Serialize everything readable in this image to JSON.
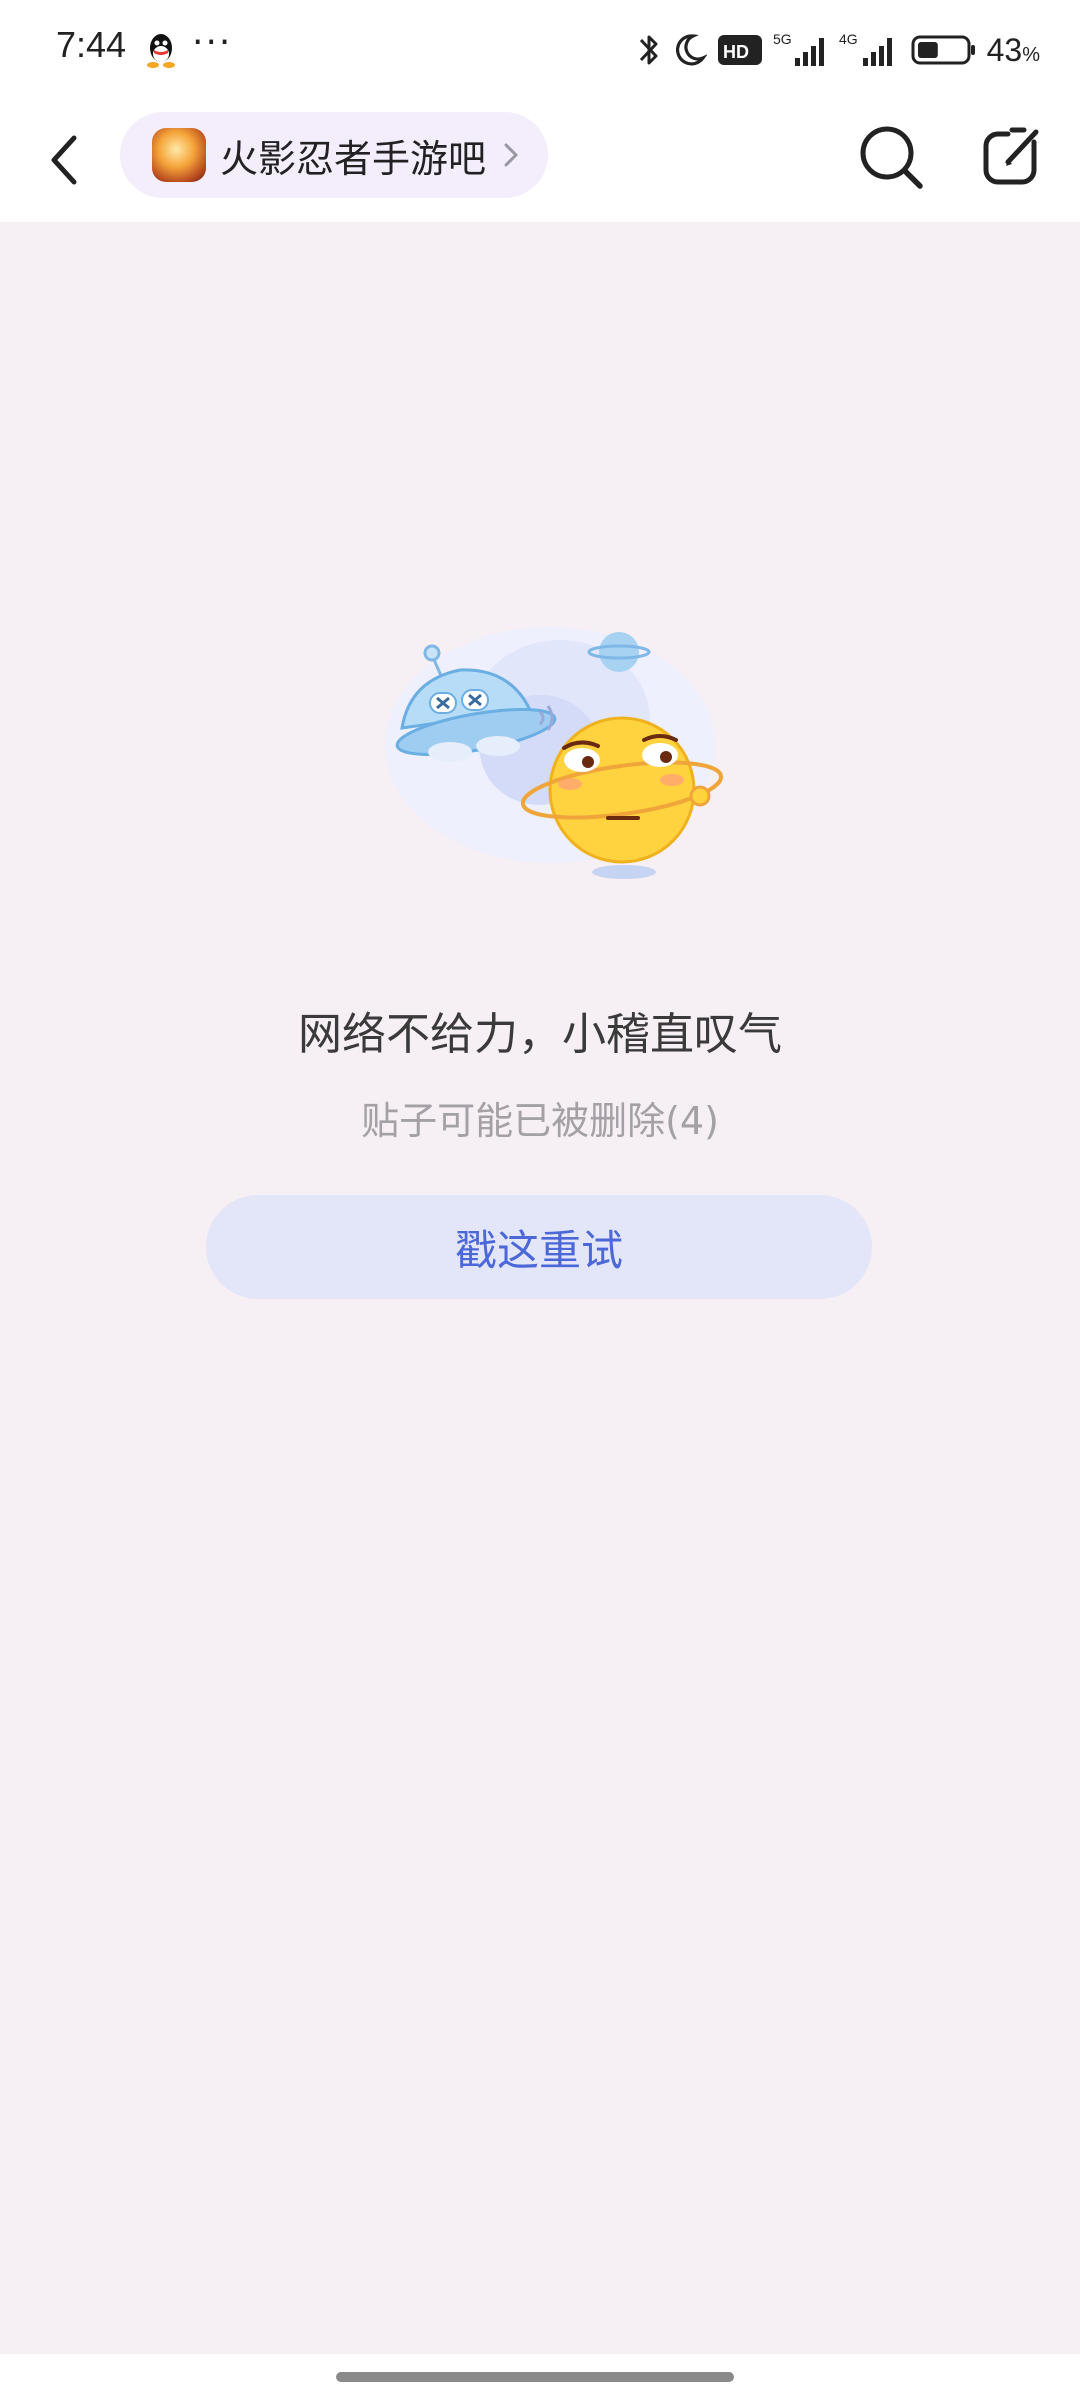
{
  "status_bar": {
    "time": "7:44",
    "more_dots": "···",
    "hd_label": "HD",
    "signal_1": "5G",
    "signal_2": "4G",
    "battery_percent": "43",
    "battery_unit": "%",
    "battery_level": 0.43,
    "icons": [
      "qq-icon",
      "bluetooth-icon",
      "moon-icon",
      "hd-icon",
      "signal-5g-icon",
      "signal-4g-icon",
      "battery-icon"
    ]
  },
  "nav": {
    "back_icon": "chevron-left-icon",
    "forum_name": "火影忍者手游吧",
    "chip_arrow_icon": "chevron-right-icon",
    "search_icon": "search-icon",
    "compose_icon": "compose-icon"
  },
  "error": {
    "illustration": "ufo-and-planet-illustration",
    "title": "网络不给力，小稽直叹气",
    "subtitle": "贴子可能已被删除(4)",
    "retry_label": "戳这重试"
  },
  "colors": {
    "page_bg": "#f6eff4",
    "chip_bg": "#f4eefc",
    "retry_bg": "#e3e5f8",
    "retry_text": "#4c68d8"
  }
}
